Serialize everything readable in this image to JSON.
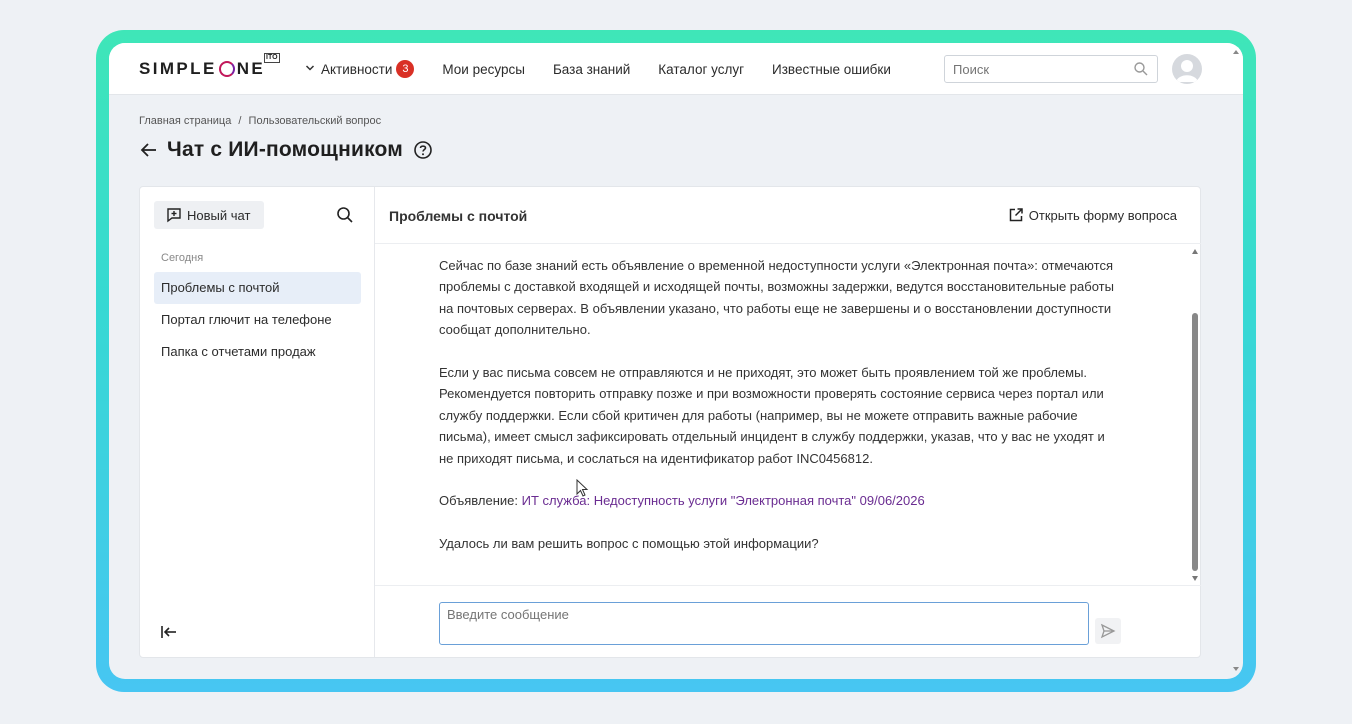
{
  "app": {
    "logo_left": "SIMPLE",
    "logo_right": "NE",
    "logo_badge": "ITO"
  },
  "nav": {
    "activities_label": "Активности",
    "activities_count": "3",
    "items": [
      "Мои ресурсы",
      "База знаний",
      "Каталог услуг",
      "Известные ошибки"
    ]
  },
  "search": {
    "placeholder": "Поиск"
  },
  "breadcrumb": {
    "home": "Главная страница",
    "separator": "/",
    "current": "Пользовательский вопрос"
  },
  "page": {
    "title": "Чат с ИИ-помощником"
  },
  "sidebar": {
    "new_chat_label": "Новый чат",
    "section_label": "Сегодня",
    "chats": [
      "Проблемы с почтой",
      "Портал глючит на телефоне",
      "Папка с отчетами продаж"
    ],
    "active_index": 0
  },
  "chat": {
    "title": "Проблемы с почтой",
    "open_form_label": "Открыть форму вопроса",
    "paragraph1": "Сейчас по базе знаний есть объявление о временной недоступности услуги «Электронная почта»: отмечаются проблемы с доставкой входящей и исходящей почты, возможны задержки, ведутся восстановительные работы на почтовых серверах. В объявлении указано, что работы еще не завершены и о восстановлении доступности сообщат дополнительно.",
    "paragraph2": "Если у вас письма совсем не отправляются и не приходят, это может быть проявлением той же проблемы. Рекомендуется повторить отправку позже и при возможности проверять состояние сервиса через портал или службу поддержки. Если сбой критичен для работы (например, вы не можете отправить важные рабочие письма), имеет смысл зафиксировать отдельный инцидент в службу поддержки, указав, что у вас не уходят и не приходят письма, и сослаться на идентификатор работ INC0456812.",
    "announcement_prefix": "Объявление:",
    "announcement_link": "ИТ служба: Недоступность услуги \"Электронная почта\" 09/06/2026",
    "question": "Удалось ли вам решить вопрос с помощью этой информации?",
    "input_placeholder": "Введите сообщение"
  },
  "colors": {
    "frame_gradient_top": "#3fe6b8",
    "frame_gradient_bottom": "#47c6f2",
    "badge": "#d93025",
    "link": "#6a2c91",
    "active_item": "#e7eef8",
    "input_border": "#6aa0d8"
  }
}
